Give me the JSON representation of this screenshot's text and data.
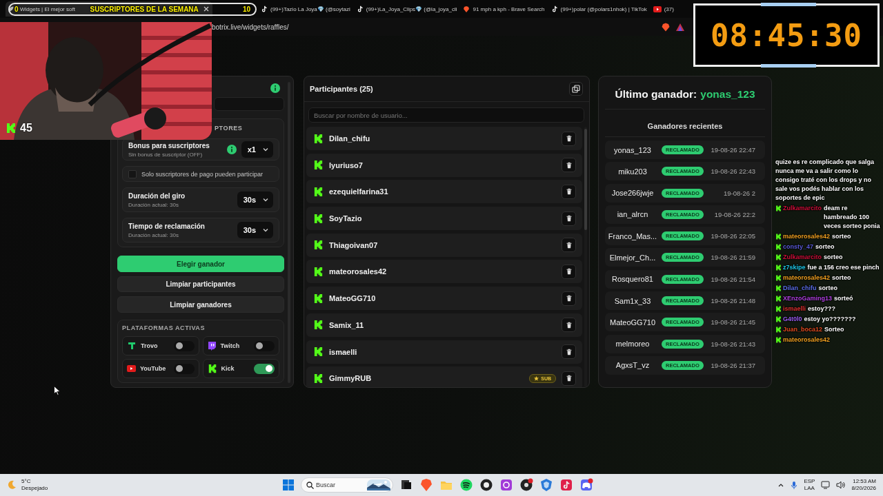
{
  "browser": {
    "tabs": [
      {
        "title": "Widgets | El mejor soft",
        "selected": true
      },
      {
        "title": "(99+)Tazio La Joya💎 (@soytazi",
        "selected": false
      },
      {
        "title": "(99+)La_Joya_Clips💎 (@la_joya_cli",
        "selected": false
      },
      {
        "title": "91 mph a kph - Brave Search",
        "selected": false
      },
      {
        "title": "(99+)polar (@polars1nhok) | TikTok",
        "selected": false
      },
      {
        "title": "(37)",
        "selected": false
      }
    ],
    "address": "botrix.live/widgets/raffles/"
  },
  "overlay": {
    "sub_goal": {
      "current": "0",
      "title": "SUSCRIPTORES DE LA SEMANA",
      "target": "10",
      "level": 0
    },
    "viewers": "45",
    "timer": "08:45:30"
  },
  "settings": {
    "section_title": "PTORES",
    "bonus": {
      "label": "Bonus para suscriptores",
      "hint": "Sin bonus de suscriptor (OFF)",
      "value": "x1"
    },
    "paid_only": {
      "label": "Solo suscriptores de pago pueden participar",
      "checked": false
    },
    "spin": {
      "label": "Duración del giro",
      "hint": "Duración actual: 30s",
      "value": "30s"
    },
    "claim": {
      "label": "Tiempo de reclamación",
      "hint": "Duración actual: 30s",
      "value": "30s"
    },
    "buttons": [
      {
        "label": "Elegir ganador",
        "kind": "primary"
      },
      {
        "label": "Limpiar participantes",
        "kind": "secondary"
      },
      {
        "label": "Limpiar ganadores",
        "kind": "secondary"
      }
    ],
    "platforms_title": "PLATAFORMAS ACTIVAS",
    "platforms": [
      {
        "name": "Trovo",
        "on": false
      },
      {
        "name": "Twitch",
        "on": false
      },
      {
        "name": "YouTube",
        "on": false
      },
      {
        "name": "Kick",
        "on": true
      }
    ]
  },
  "participants": {
    "title": "Participantes (25)",
    "search": {
      "placeholder": "Buscar por nombre de usuario..."
    },
    "list": [
      {
        "name": "Dilan_chifu",
        "sub": false
      },
      {
        "name": "lyuriuso7",
        "sub": false
      },
      {
        "name": "ezequielfarina31",
        "sub": false
      },
      {
        "name": "SoyTazio",
        "sub": false
      },
      {
        "name": "Thiagoivan07",
        "sub": false
      },
      {
        "name": "mateorosales42",
        "sub": false
      },
      {
        "name": "MateoGG710",
        "sub": false
      },
      {
        "name": "Samix_11",
        "sub": false
      },
      {
        "name": "ismaelli",
        "sub": false
      },
      {
        "name": "GimmyRUB",
        "sub": true,
        "badge": "SUB"
      }
    ]
  },
  "winners": {
    "label": "Último ganador:",
    "last": "yonas_123",
    "recent_title": "Ganadores recientes",
    "list": [
      {
        "name": "yonas_123",
        "status": "RECLAMADO",
        "date": "19-08-26 22:47"
      },
      {
        "name": "miku203",
        "status": "RECLAMADO",
        "date": "19-08-26 22:43"
      },
      {
        "name": "Jose266jwje",
        "status": "RECLAMADO",
        "date": "19-08-26 2"
      },
      {
        "name": "ian_alrcn",
        "status": "RECLAMADO",
        "date": "19-08-26 22:2"
      },
      {
        "name": "Franco_Mas...",
        "status": "RECLAMADO",
        "date": "19-08-26 22:05"
      },
      {
        "name": "Elmejor_Ch...",
        "status": "RECLAMADO",
        "date": "19-08-26 21:59"
      },
      {
        "name": "Rosquero81",
        "status": "RECLAMADO",
        "date": "19-08-26 21:54"
      },
      {
        "name": "Sam1x_33",
        "status": "RECLAMADO",
        "date": "19-08-26 21:48"
      },
      {
        "name": "MateoGG710",
        "status": "RECLAMADO",
        "date": "19-08-26 21:45"
      },
      {
        "name": "melmoreo",
        "status": "RECLAMADO",
        "date": "19-08-26 21:43"
      },
      {
        "name": "AgxsT_vz",
        "status": "RECLAMADO",
        "date": "19-08-26 21:37"
      }
    ]
  },
  "chat": [
    {
      "text": "quize es re complicado que salga nunca me va a salir como lo consigo traté con los drops y no sale vos podés hablar con los soportes de epic"
    },
    {
      "user": "Zulkamarcito",
      "color": "#d0103a",
      "text": "deam re hambreado 100 veces sorteo ponia"
    },
    {
      "user": "mateorosales42",
      "color": "#f0a020",
      "text": "sorteo"
    },
    {
      "user": "consty_47",
      "color": "#5a5ad8",
      "text": "sorteo"
    },
    {
      "user": "Zulkamarcito",
      "color": "#d0103a",
      "text": "sorteo"
    },
    {
      "user": "z7skipe",
      "color": "#1ec8e8",
      "text": "fue a 156 creo ese pinch"
    },
    {
      "user": "mateorosales42",
      "color": "#f0a020",
      "text": "sorteo"
    },
    {
      "user": "Dilan_chifu",
      "color": "#5b6ee8",
      "text": "sorteo"
    },
    {
      "user": "XEnzoGaming13",
      "color": "#b040e0",
      "text": "sorteó"
    },
    {
      "user": "ismaelli",
      "color": "#e03030",
      "text": "estoy???"
    },
    {
      "user": "G4t0l0",
      "color": "#9a5cf0",
      "text": "estoy yo???????"
    },
    {
      "user": "Juan_boca12",
      "color": "#e04a20",
      "text": "Sorteo"
    },
    {
      "user": "mateorosales42",
      "color": "#f0a020"
    }
  ],
  "taskbar": {
    "weather": {
      "temp": "5°C",
      "text": "Despejado"
    },
    "search": {
      "placeholder": "Buscar"
    },
    "language": {
      "code": "ESP",
      "layout": "LAA"
    },
    "clock": {
      "time": "12:53 AM",
      "date": "8/20/2026"
    }
  }
}
